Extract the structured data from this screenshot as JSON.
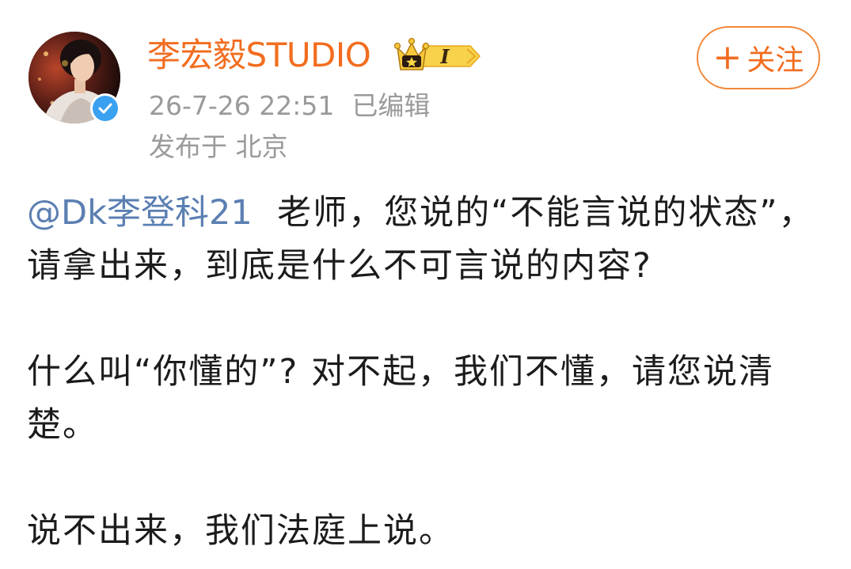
{
  "post": {
    "author": {
      "name": "李宏毅STUDIO",
      "verified_icon": "verified-check-icon",
      "vip_badge_icon": "crown-level-icon",
      "vip_level": "I"
    },
    "timestamp": "26-7-26 22:51",
    "edited_label": "已编辑",
    "location": "发布于 北京",
    "follow_button": {
      "plus": "+",
      "label": "关注"
    },
    "content": {
      "mention": "@Dk李登科21",
      "paragraph1_rest": "老师，您说的“不能言说的状态”，请拿出来，到底是什么不可言说的内容?",
      "paragraph2": "什么叫“你懂的”? 对不起，我们不懂，请您说清楚。",
      "paragraph3": "说不出来，我们法庭上说。"
    }
  },
  "colors": {
    "username": "#f26d1f",
    "follow_border": "#f2883a",
    "meta": "#9a9a9a",
    "mention": "#5b7fb2",
    "body_text": "#1c1c1c",
    "verified": "#3aa0f0",
    "vip_gold": "#f7c83a"
  }
}
